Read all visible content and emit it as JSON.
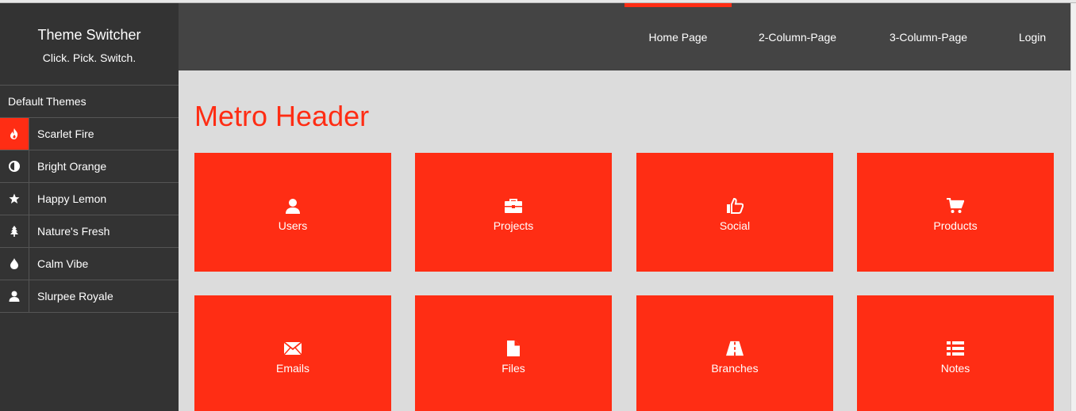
{
  "sidebar": {
    "title": "Theme Switcher",
    "tagline": "Click. Pick. Switch.",
    "section_label": "Default Themes",
    "items": [
      {
        "label": "Scarlet Fire",
        "icon": "fire-icon",
        "active": true
      },
      {
        "label": "Bright Orange",
        "icon": "half-circle-icon",
        "active": false
      },
      {
        "label": "Happy Lemon",
        "icon": "star-icon",
        "active": false
      },
      {
        "label": "Nature's Fresh",
        "icon": "tree-icon",
        "active": false
      },
      {
        "label": "Calm Vibe",
        "icon": "drop-icon",
        "active": false
      },
      {
        "label": "Slurpee Royale",
        "icon": "user-icon",
        "active": false
      }
    ]
  },
  "nav": {
    "home": "Home Page",
    "two_col": "2-Column-Page",
    "three_col": "3-Column-Page",
    "login": "Login"
  },
  "main": {
    "title": "Metro Header",
    "tiles": [
      {
        "label": "Users",
        "icon": "user-icon"
      },
      {
        "label": "Projects",
        "icon": "briefcase-icon"
      },
      {
        "label": "Social",
        "icon": "thumbs-up-icon"
      },
      {
        "label": "Products",
        "icon": "cart-icon"
      },
      {
        "label": "Emails",
        "icon": "envelope-icon"
      },
      {
        "label": "Files",
        "icon": "file-icon"
      },
      {
        "label": "Branches",
        "icon": "road-icon"
      },
      {
        "label": "Notes",
        "icon": "list-icon"
      }
    ]
  },
  "colors": {
    "accent": "#ff2d14",
    "sidebar_bg": "#333333",
    "topnav_bg": "#444444",
    "content_bg": "#dcdcdc"
  }
}
